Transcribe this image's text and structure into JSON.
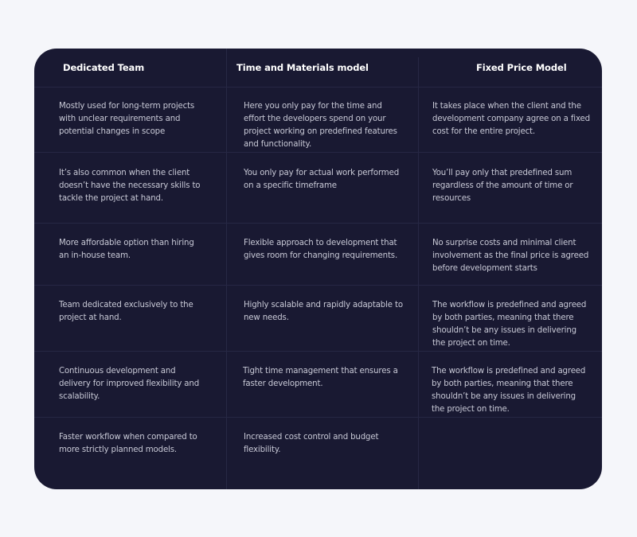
{
  "table": {
    "columns": [
      {
        "header": "Dedicated Team",
        "cells": [
          "Mostly used for long-term projects with unclear requirements and potential changes in scope",
          "It’s also common when the client doesn’t have the necessary skills to tackle the project at hand.",
          "More affordable option than hiring an in-house team.",
          "Team dedicated exclusively to the project at hand.",
          "Continuous development and delivery for improved flexibility and scalability.",
          "Faster workflow when compared to more strictly planned models."
        ]
      },
      {
        "header": "Time and Materials model",
        "cells": [
          "Here you only pay for the time and effort the developers spend on your project working on predefined features and functionality.",
          "You only pay for actual work performed on a specific timeframe",
          "Flexible approach to development that gives room for changing requirements.",
          "Highly scalable and rapidly adaptable to new needs.",
          "Tight time management that ensures a faster development.",
          "Increased cost control and budget flexibility."
        ]
      },
      {
        "header": "Fixed Price Model",
        "cells": [
          "It takes place when the client and the development company agree on a fixed cost for the entire project.",
          "You’ll pay only that predefined sum regardless of the amount of time or resources",
          "No surprise costs and minimal client involvement as the final price is agreed before development starts",
          "The workflow is predefined and agreed by both parties, meaning that there shouldn’t be any issues in delivering the project on time.",
          "The workflow is predefined and agreed by both parties, meaning that there shouldn’t be any issues in delivering the project on time.",
          ""
        ]
      }
    ]
  },
  "colors": {
    "page_background": "#f5f6fa",
    "card_background": "#191932",
    "header_text": "#ffffff",
    "body_text": "#c8c9d6",
    "divider": "#272845"
  }
}
